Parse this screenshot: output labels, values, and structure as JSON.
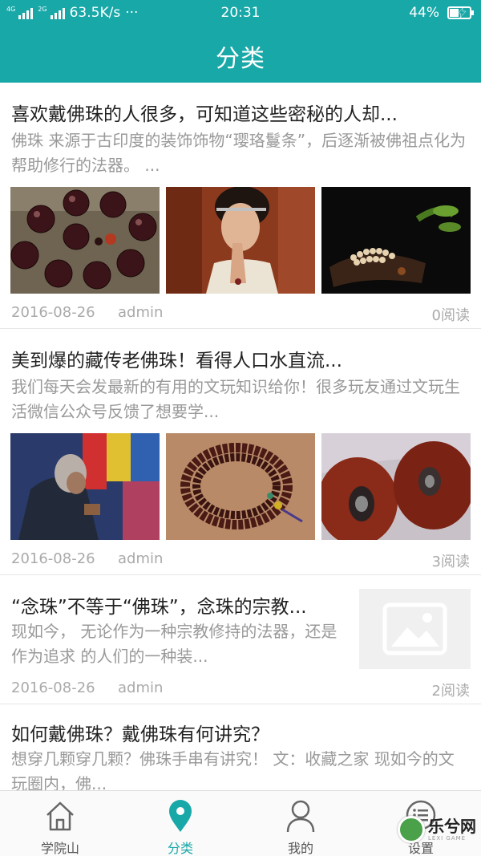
{
  "status_bar": {
    "net_4g": "4G",
    "net_2g": "2G",
    "speed": "63.5K/s",
    "dots": "···",
    "time": "20:31",
    "battery": "44%"
  },
  "header": {
    "title": "分类"
  },
  "articles": [
    {
      "title": "喜欢戴佛珠的人很多，可知道这些密秘的人却...",
      "desc": "佛珠 来源于古印度的装饰饰物“璎珞鬘条”，后逐渐被佛祖点化为帮助修行的法器。 ...",
      "date": "2016-08-26",
      "author": "admin",
      "reads": "0阅读"
    },
    {
      "title": "美到爆的藏传老佛珠！看得人口水直流...",
      "desc": "我们每天会发最新的有用的文玩知识给你！很多玩友通过文玩生活微信公众号反馈了想要学...",
      "date": "2016-08-26",
      "author": "admin",
      "reads": "3阅读"
    },
    {
      "title": "“念珠”不等于“佛珠”，念珠的宗教...",
      "desc": "现如今， 无论作为一种宗教修持的法器，还是作为追求 的人们的一种装...",
      "date": "2016-08-26",
      "author": "admin",
      "reads": "2阅读"
    },
    {
      "title": "如何戴佛珠？戴佛珠有何讲究？",
      "desc": "想穿几颗穿几颗？佛珠手串有讲究！ 文：收藏之家 现如今的文玩圈内，佛..."
    }
  ],
  "tabs": [
    {
      "label": "学院山",
      "icon": "home-icon"
    },
    {
      "label": "分类",
      "icon": "location-pin-icon",
      "active": true
    },
    {
      "label": "我的",
      "icon": "person-icon"
    },
    {
      "label": "设置",
      "icon": "settings-list-icon"
    }
  ],
  "watermark": {
    "text": "乐兮网",
    "sub": "LEXI GAME"
  },
  "colors": {
    "accent": "#18a8a8",
    "text": "#222222",
    "muted": "#999999"
  }
}
